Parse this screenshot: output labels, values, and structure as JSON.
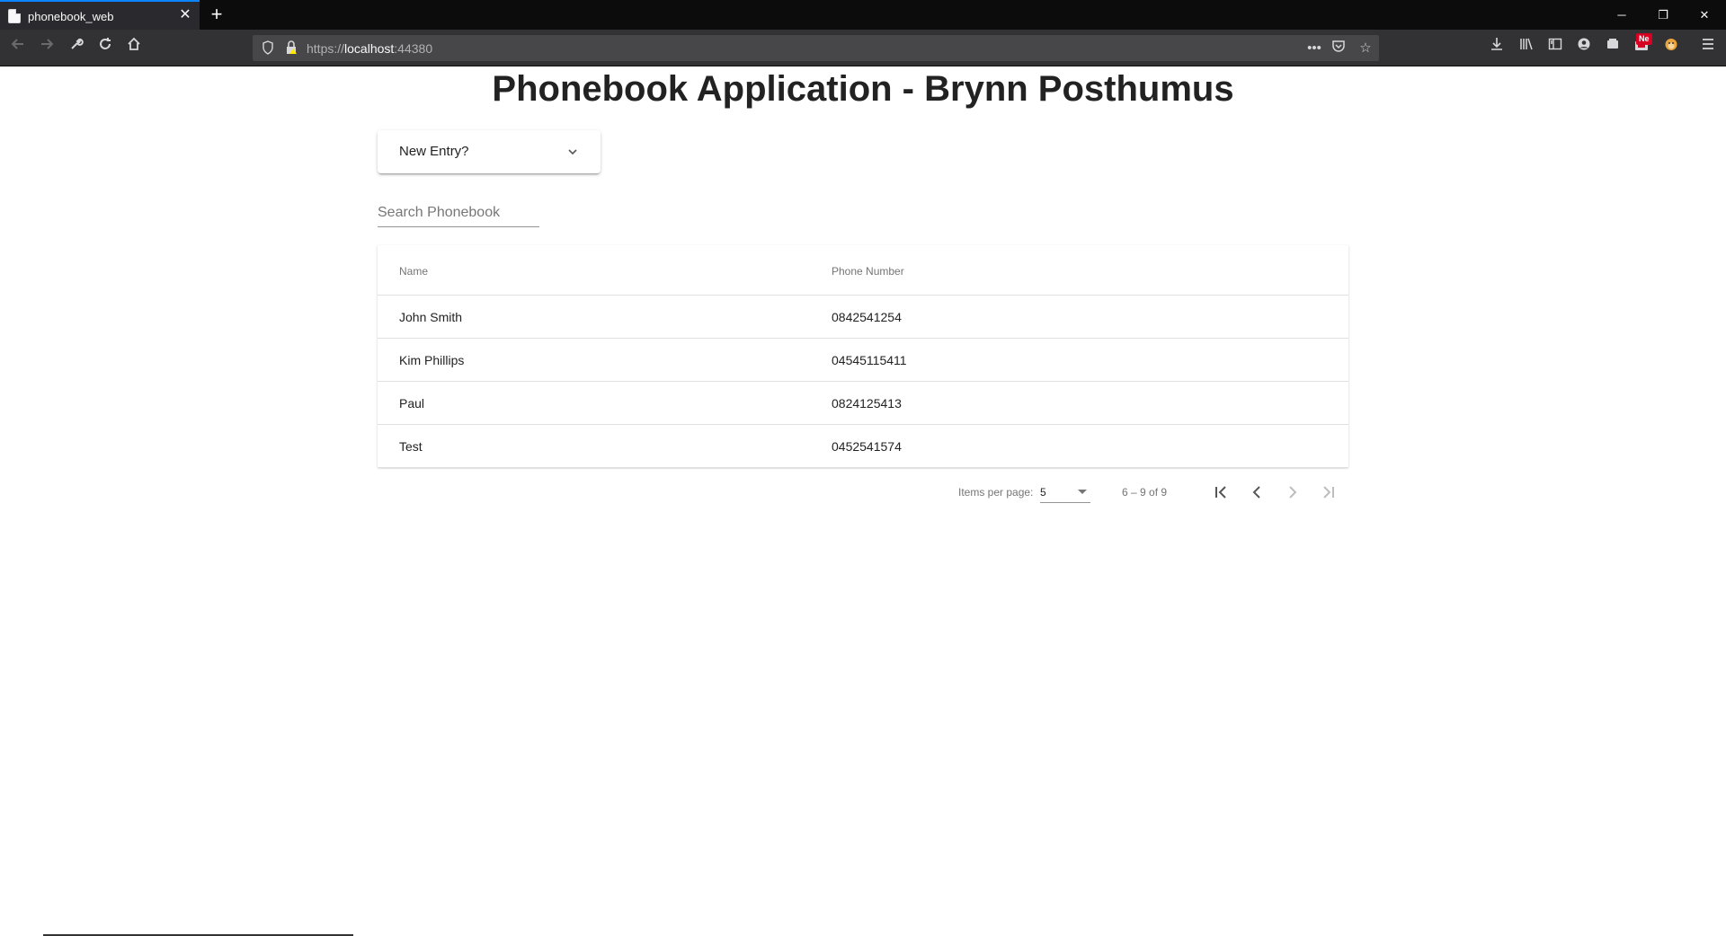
{
  "browser": {
    "tab_title": "phonebook_web",
    "url_scheme": "https://",
    "url_host": "localhost",
    "url_port": ":44380",
    "notification_badge": "Ne"
  },
  "page": {
    "title": "Phonebook Application - Brynn Posthumus",
    "new_entry_label": "New Entry?",
    "search_placeholder": "Search Phonebook"
  },
  "table": {
    "columns": [
      "Name",
      "Phone Number"
    ],
    "rows": [
      {
        "name": "John Smith",
        "phone": "0842541254"
      },
      {
        "name": "Kim Phillips",
        "phone": "04545115411"
      },
      {
        "name": "Paul",
        "phone": "0824125413"
      },
      {
        "name": "Test",
        "phone": "0452541574"
      }
    ]
  },
  "paginator": {
    "items_per_page_label": "Items per page:",
    "items_per_page_value": "5",
    "range_label": "6 – 9 of 9"
  }
}
